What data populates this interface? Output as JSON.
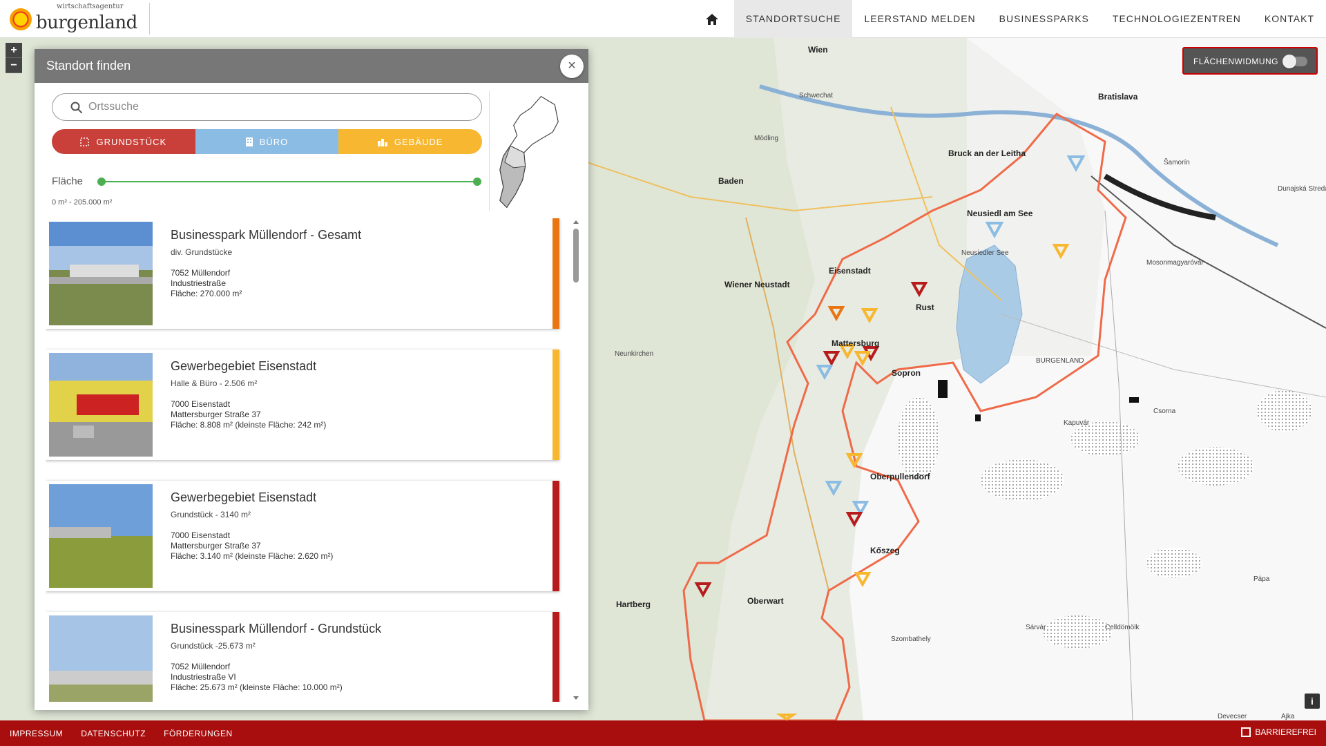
{
  "header": {
    "logo_small": "wirtschaftsagentur",
    "logo_big": "burgenland",
    "nav": [
      {
        "label": "STANDORTSUCHE"
      },
      {
        "label": "LEERSTAND MELDEN"
      },
      {
        "label": "BUSINESSPARKS"
      },
      {
        "label": "TECHNOLOGIEZENTREN"
      },
      {
        "label": "KONTAKT"
      }
    ]
  },
  "map": {
    "zoom_in": "+",
    "zoom_out": "−",
    "toggle_label": "FLÄCHENWIDMUNG",
    "info": "i",
    "labels": [
      {
        "text": "Wien",
        "big": true
      },
      {
        "text": "Bratislava",
        "big": true
      },
      {
        "text": "Bruck an der Leitha",
        "big": true
      },
      {
        "text": "Neusiedl am See",
        "big": true
      },
      {
        "text": "Eisenstadt",
        "big": true
      },
      {
        "text": "Rust",
        "big": true
      },
      {
        "text": "Mattersburg",
        "big": true
      },
      {
        "text": "Sopron",
        "big": true
      },
      {
        "text": "Wiener Neustadt",
        "big": true
      },
      {
        "text": "Baden",
        "big": true
      },
      {
        "text": "Oberpullendorf",
        "big": true
      },
      {
        "text": "Oberwart",
        "big": true
      },
      {
        "text": "Hartberg",
        "big": true
      },
      {
        "text": "Kőszeg",
        "big": true
      },
      {
        "text": "Szombathely",
        "big": false
      },
      {
        "text": "Kapuvár",
        "big": false
      },
      {
        "text": "Csorna",
        "big": false
      },
      {
        "text": "Mosonmagyaróvár",
        "big": false
      },
      {
        "text": "Šamorín",
        "big": false
      },
      {
        "text": "Pápa",
        "big": false
      },
      {
        "text": "Celldömölk",
        "big": false
      },
      {
        "text": "Sárvár",
        "big": false
      },
      {
        "text": "Neunkirchen",
        "big": false
      },
      {
        "text": "Schwechat",
        "big": false
      },
      {
        "text": "Mödling",
        "big": false
      },
      {
        "text": "Devecser",
        "big": false
      },
      {
        "text": "Ajka",
        "big": false
      },
      {
        "text": "Dunajská Streda",
        "big": false
      },
      {
        "text": "Neusiedler See",
        "big": false
      },
      {
        "text": "BURGENLAND",
        "big": false
      }
    ]
  },
  "panel": {
    "title": "Standort finden",
    "close": "×",
    "search_placeholder": "Ortssuche",
    "types": [
      {
        "label": "GRUNDSTÜCK",
        "color": "#c9403a"
      },
      {
        "label": "BÜRO",
        "color": "#8bbce4"
      },
      {
        "label": "GEBÄUDE",
        "color": "#f7b731"
      }
    ],
    "area_label": "Fläche",
    "area_range": "0 m² - 205.000 m²",
    "results": [
      {
        "title": "Businesspark Müllendorf - Gesamt",
        "sub": "div. Grundstücke",
        "city": "7052 Müllendorf",
        "street": "Industriestraße",
        "area": "Fläche: 270.000 m²",
        "color": "#e87511"
      },
      {
        "title": "Gewerbegebiet Eisenstadt",
        "sub": "Halle & Büro - 2.506 m²",
        "city": "7000 Eisenstadt",
        "street": "Mattersburger Straße 37",
        "area": "Fläche: 8.808 m² (kleinste Fläche: 242 m²)",
        "color": "#f7b731"
      },
      {
        "title": "Gewerbegebiet Eisenstadt",
        "sub": "Grundstück - 3140 m²",
        "city": "7000 Eisenstadt",
        "street": "Mattersburger Straße 37",
        "area": "Fläche: 3.140 m² (kleinste Fläche: 2.620 m²)",
        "color": "#b71c1c"
      },
      {
        "title": "Businesspark Müllendorf - Grundstück",
        "sub": "Grundstück -25.673 m²",
        "city": "7052 Müllendorf",
        "street": "Industriestraße VI",
        "area": "Fläche: 25.673 m² (kleinste Fläche: 10.000 m²)",
        "color": "#b71c1c"
      }
    ]
  },
  "footer": {
    "links": [
      {
        "label": "IMPRESSUM"
      },
      {
        "label": "DATENSCHUTZ"
      },
      {
        "label": "FÖRDERUNGEN"
      }
    ],
    "barrierefrei": "BARRIEREFREI"
  }
}
